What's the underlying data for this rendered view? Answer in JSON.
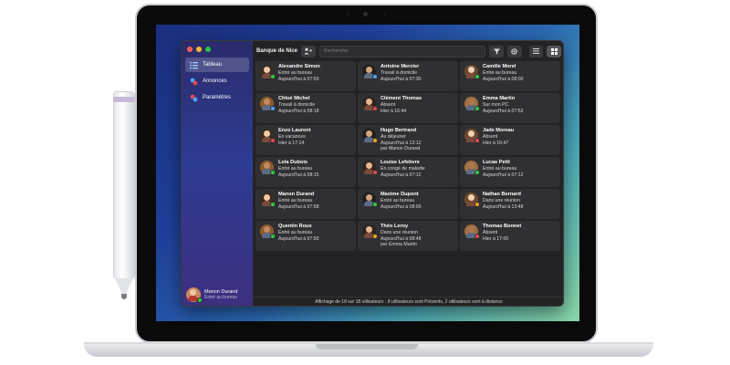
{
  "app": {
    "organization": "Banque de Nice",
    "search_placeholder": "Recherche",
    "footer": "Affichage de 18 sur 18 utilisateurs · 8 utilisateurs sont Présents, 2 utilisateurs sont à distance"
  },
  "sidebar": {
    "items": [
      {
        "label": "Tableau",
        "icon": "dashboard-icon",
        "active": true
      },
      {
        "label": "Annonces",
        "icon": "announcements-icon",
        "active": false
      },
      {
        "label": "Paramètres",
        "icon": "settings-icon",
        "active": false
      }
    ],
    "user": {
      "name": "Manon Durand",
      "status": "Entré au bureau"
    }
  },
  "toolbar": {
    "add_user_icon": "add-user-icon",
    "filter_icon": "filter-icon",
    "gear_icon": "gear-icon",
    "list_view_icon": "list-view-icon",
    "grid_view_icon": "grid-view-icon"
  },
  "colors": {
    "present": "#2ecc40",
    "absent": "#e5484d",
    "remote": "#4da3ff",
    "away": "#f5a623"
  },
  "people": [
    {
      "name": "Alexandre Simon",
      "status": "Entré au bureau",
      "time": "Aujourd'hui à 07:50",
      "extra": "",
      "badge": "present"
    },
    {
      "name": "Antoine Mercier",
      "status": "Travail à domicile",
      "time": "Aujourd'hui à 07:30",
      "extra": "",
      "badge": "remote"
    },
    {
      "name": "Camille Morel",
      "status": "Entré au bureau",
      "time": "Aujourd'hui à 08:00",
      "extra": "",
      "badge": "present"
    },
    {
      "name": "Chloé Michel",
      "status": "Travail à domicile",
      "time": "Aujourd'hui à 08:18",
      "extra": "",
      "badge": "remote"
    },
    {
      "name": "Clément Thomas",
      "status": "Absent",
      "time": "Hier à 16:44",
      "extra": "",
      "badge": "absent"
    },
    {
      "name": "Emma Martin",
      "status": "Sur mon PC",
      "time": "Aujourd'hui à 07:52",
      "extra": "",
      "badge": "present"
    },
    {
      "name": "Enzo Laurent",
      "status": "En vacances",
      "time": "Hier à 17:14",
      "extra": "",
      "badge": "absent"
    },
    {
      "name": "Hugo Bertrand",
      "status": "Au déjeuner",
      "time": "Aujourd'hui à 12:12",
      "extra": "par Manon Durand",
      "badge": "away"
    },
    {
      "name": "Jade Moreau",
      "status": "Absent",
      "time": "Hier à 16:47",
      "extra": "",
      "badge": "absent"
    },
    {
      "name": "Lola Dubois",
      "status": "Entré au bureau",
      "time": "Aujourd'hui à 08:15",
      "extra": "",
      "badge": "present"
    },
    {
      "name": "Louise Lefebvre",
      "status": "En congé de maladie",
      "time": "Aujourd'hui à 07:12",
      "extra": "",
      "badge": "absent"
    },
    {
      "name": "Lucas Petit",
      "status": "Entré au bureau",
      "time": "Aujourd'hui à 07:12",
      "extra": "",
      "badge": "present"
    },
    {
      "name": "Manon Durand",
      "status": "Entré au bureau",
      "time": "Aujourd'hui à 07:58",
      "extra": "",
      "badge": "present"
    },
    {
      "name": "Maxime Dupont",
      "status": "Entré au bureau",
      "time": "Aujourd'hui à 08:00",
      "extra": "",
      "badge": "present"
    },
    {
      "name": "Nathan Bernard",
      "status": "Dans une réunion",
      "time": "Aujourd'hui à 13:48",
      "extra": "",
      "badge": "away"
    },
    {
      "name": "Quentin Roux",
      "status": "Entré au bureau",
      "time": "Aujourd'hui à 07:50",
      "extra": "",
      "badge": "present"
    },
    {
      "name": "Théo Leroy",
      "status": "Dans une réunion",
      "time": "Aujourd'hui à 08:48",
      "extra": "par Emma Martin",
      "badge": "away"
    },
    {
      "name": "Thomas Bonnet",
      "status": "Absent",
      "time": "Hier à 17:00",
      "extra": "",
      "badge": "absent"
    }
  ]
}
